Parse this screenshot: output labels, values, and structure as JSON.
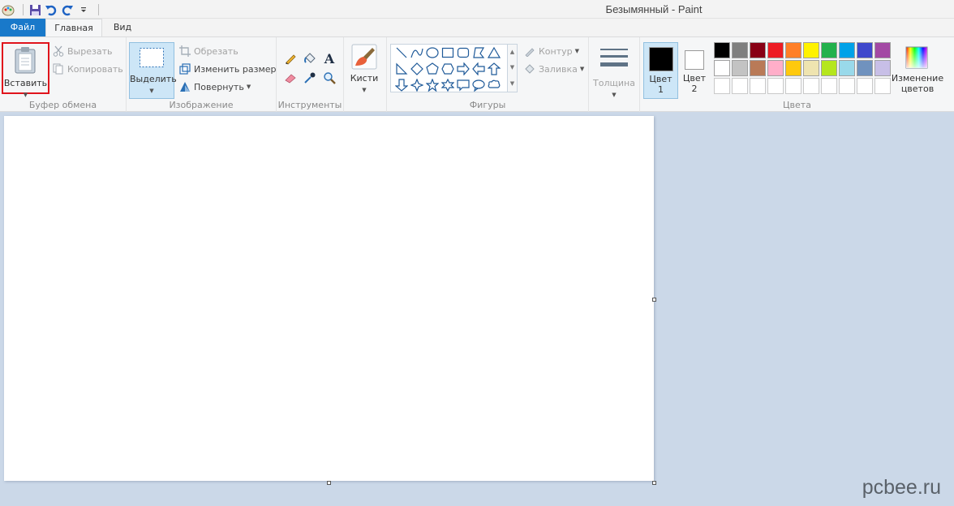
{
  "window": {
    "title": "Безымянный - Paint"
  },
  "tabs": {
    "file": "Файл",
    "home": "Главная",
    "view": "Вид"
  },
  "clipboard": {
    "paste": "Вставить",
    "cut": "Вырезать",
    "copy": "Копировать",
    "group_label": "Буфер обмена"
  },
  "image": {
    "select": "Выделить",
    "crop": "Обрезать",
    "resize": "Изменить размер",
    "rotate": "Повернуть",
    "group_label": "Изображение"
  },
  "tools": {
    "group_label": "Инструменты"
  },
  "brushes": {
    "label": "Кисти"
  },
  "shapes": {
    "outline": "Контур",
    "fill": "Заливка",
    "group_label": "Фигуры"
  },
  "size": {
    "label": "Толщина"
  },
  "colors": {
    "color1_line1": "Цвет",
    "color1_line2": "1",
    "color2_line1": "Цвет",
    "color2_line2": "2",
    "edit_line1": "Изменение",
    "edit_line2": "цветов",
    "group_label": "Цвета",
    "color1": "#000000",
    "color2": "#ffffff",
    "palette": [
      "#000000",
      "#7f7f7f",
      "#880015",
      "#ed1c24",
      "#ff7f27",
      "#fff200",
      "#22b14c",
      "#00a2e8",
      "#3f48cc",
      "#a349a4",
      "#ffffff",
      "#c3c3c3",
      "#b97a57",
      "#ffaec9",
      "#ffc90e",
      "#efe4b0",
      "#b5e61d",
      "#99d9ea",
      "#7092be",
      "#c8bfe7",
      "#ffffff",
      "#ffffff",
      "#ffffff",
      "#ffffff",
      "#ffffff",
      "#ffffff",
      "#ffffff",
      "#ffffff",
      "#ffffff",
      "#ffffff"
    ]
  },
  "watermark": "pcbee.ru"
}
